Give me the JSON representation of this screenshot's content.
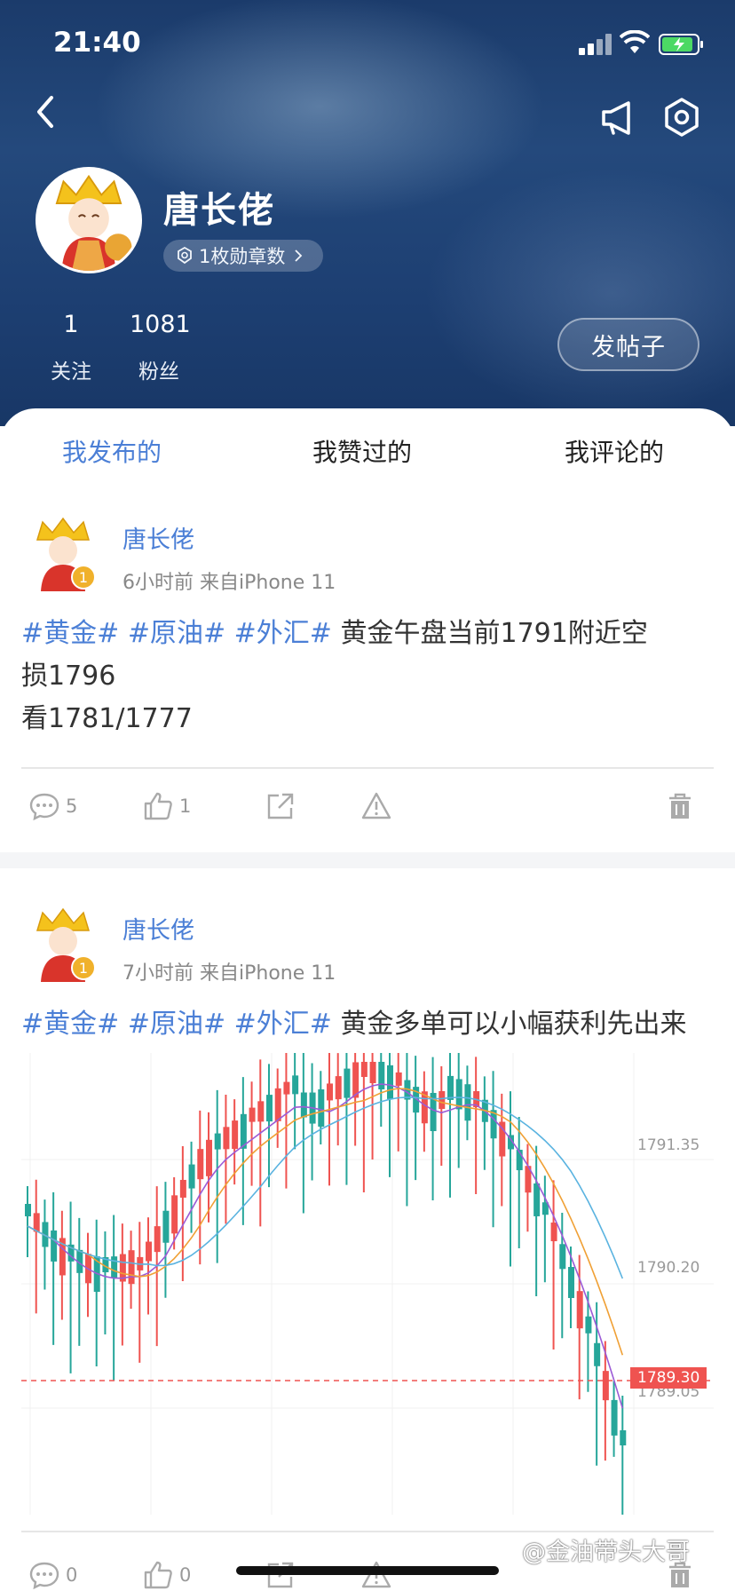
{
  "status_bar": {
    "time": "21:40"
  },
  "profile": {
    "name": "唐长佬",
    "badge_label": "1枚勋章数",
    "stats": [
      {
        "value": "1",
        "label": "关注"
      },
      {
        "value": "1081",
        "label": "粉丝"
      }
    ],
    "post_button": "发帖子"
  },
  "tabs": [
    {
      "label": "我发布的",
      "active": true
    },
    {
      "label": "我赞过的",
      "active": false
    },
    {
      "label": "我评论的",
      "active": false
    }
  ],
  "posts": [
    {
      "author": "唐长佬",
      "meta": "6小时前  来自iPhone 11",
      "tags": [
        "#黄金#",
        "#原油#",
        "#外汇#"
      ],
      "text_lines": [
        "黄金午盘当前1791附近空",
        "损1796",
        "看1781/1777"
      ],
      "comments": "5",
      "likes": "1"
    },
    {
      "author": "唐长佬",
      "meta": "7小时前  来自iPhone 11",
      "tags": [
        "#黄金#",
        "#原油#",
        "#外汇#"
      ],
      "text": "黄金多单可以小幅获利先出来",
      "comments": "0",
      "likes": "0"
    }
  ],
  "chart_data": {
    "type": "candlestick",
    "y_ticks": [
      "1791.35",
      "1790.20",
      "1789.05"
    ],
    "current_price": "1789.30",
    "colors": {
      "up": "#ef5350",
      "down": "#26a69a",
      "ma5": "#9c5bd6",
      "ma10": "#f0a035",
      "ma20": "#5ab3e0",
      "price_line": "#ef5350"
    }
  },
  "watermark": "@金油带头大哥",
  "colors": {
    "accent": "#4b7fd6",
    "header_bg": "#1f4274"
  }
}
